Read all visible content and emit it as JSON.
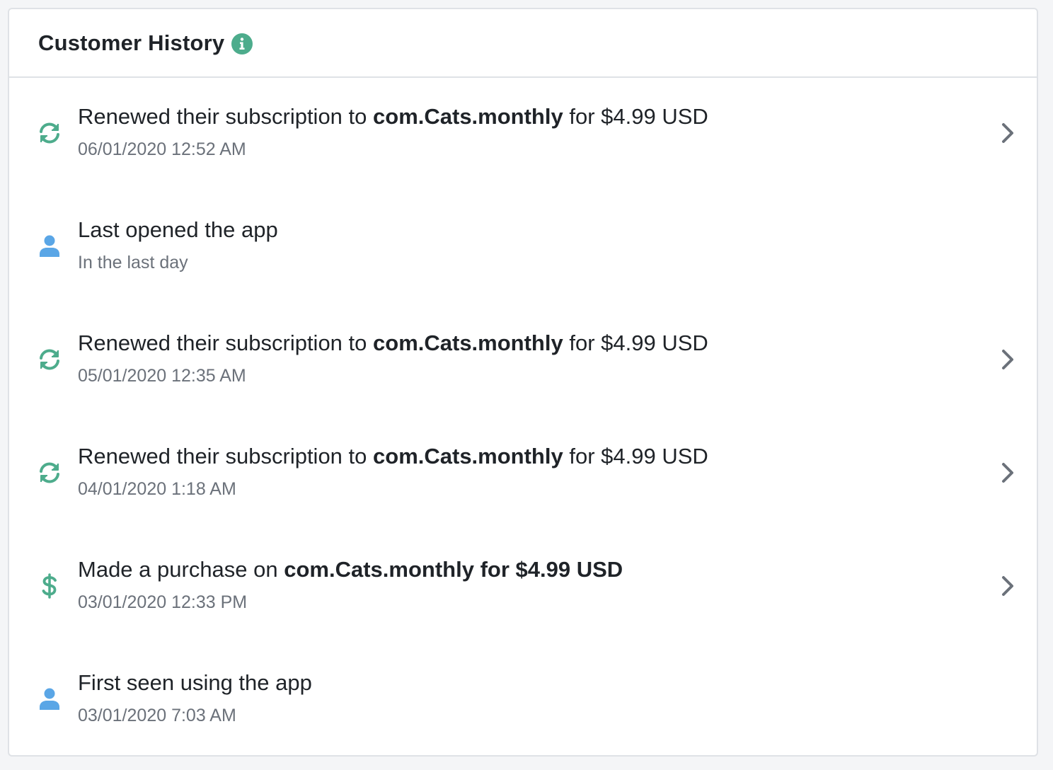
{
  "header": {
    "title": "Customer History",
    "info_icon": "info-icon"
  },
  "colors": {
    "green": "#4dac8c",
    "blue": "#5aa6e6",
    "chevron": "#6b717a"
  },
  "events": [
    {
      "icon": "refresh-icon",
      "prefix": "Renewed their subscription to ",
      "product": "com.Cats.monthly",
      "suffix": " for $4.99 USD",
      "subtitle": "06/01/2020 12:52 AM",
      "has_chevron": true
    },
    {
      "icon": "user-icon",
      "prefix": "Last opened the app",
      "product": "",
      "suffix": "",
      "subtitle": "In the last day",
      "has_chevron": false
    },
    {
      "icon": "refresh-icon",
      "prefix": "Renewed their subscription to ",
      "product": "com.Cats.monthly",
      "suffix": " for $4.99 USD",
      "subtitle": "05/01/2020 12:35 AM",
      "has_chevron": true
    },
    {
      "icon": "refresh-icon",
      "prefix": "Renewed their subscription to ",
      "product": "com.Cats.monthly",
      "suffix": " for $4.99 USD",
      "subtitle": "04/01/2020 1:18 AM",
      "has_chevron": true
    },
    {
      "icon": "dollar-icon",
      "prefix": "Made a purchase on ",
      "product": "com.Cats.monthly for $4.99 USD",
      "suffix": "",
      "subtitle": "03/01/2020 12:33 PM",
      "has_chevron": true
    },
    {
      "icon": "user-icon",
      "prefix": "First seen using the app",
      "product": "",
      "suffix": "",
      "subtitle": "03/01/2020 7:03 AM",
      "has_chevron": false
    }
  ]
}
